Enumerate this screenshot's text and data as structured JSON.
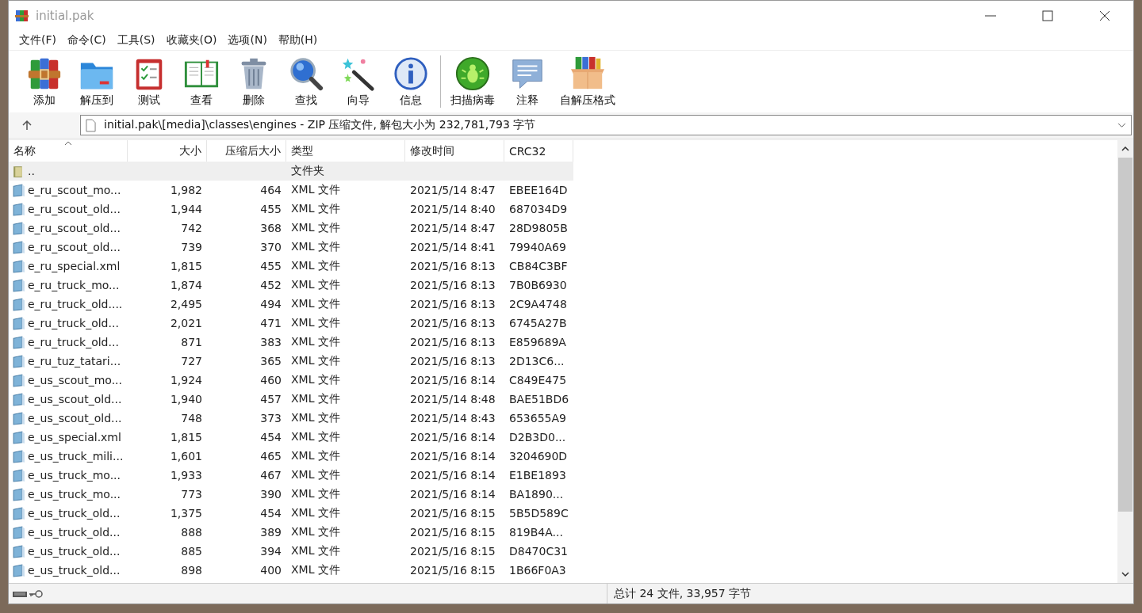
{
  "window": {
    "title": "initial.pak"
  },
  "menu": [
    "文件(F)",
    "命令(C)",
    "工具(S)",
    "收藏夹(O)",
    "选项(N)",
    "帮助(H)"
  ],
  "toolbar": {
    "groups": [
      {
        "buttons": [
          "添加",
          "解压到",
          "测试",
          "查看",
          "删除",
          "查找",
          "向导",
          "信息"
        ]
      },
      {
        "buttons": [
          "扫描病毒",
          "注释",
          "自解压格式"
        ]
      }
    ]
  },
  "address": {
    "path": "initial.pak\\[media]\\classes\\engines - ZIP 压缩文件, 解包大小为 232,781,793 字节"
  },
  "table": {
    "columns": [
      {
        "label": "名称",
        "sorted": true
      },
      {
        "label": "大小",
        "sorted": false
      },
      {
        "label": "压缩后大小",
        "sorted": false
      },
      {
        "label": "类型",
        "sorted": false
      },
      {
        "label": "修改时间",
        "sorted": false
      },
      {
        "label": "CRC32",
        "sorted": false
      }
    ],
    "rows": [
      {
        "kind": "parent",
        "selected": true,
        "cells": [
          "..",
          "",
          "",
          "文件夹",
          "",
          ""
        ]
      },
      {
        "kind": "file",
        "selected": false,
        "cells": [
          "e_ru_scout_mo...",
          "1,982",
          "464",
          "XML 文件",
          "2021/5/14 8:47",
          "EBEE164D"
        ]
      },
      {
        "kind": "file",
        "selected": false,
        "cells": [
          "e_ru_scout_old...",
          "1,944",
          "455",
          "XML 文件",
          "2021/5/14 8:40",
          "687034D9"
        ]
      },
      {
        "kind": "file",
        "selected": false,
        "cells": [
          "e_ru_scout_old...",
          "742",
          "368",
          "XML 文件",
          "2021/5/14 8:47",
          "28D9805B"
        ]
      },
      {
        "kind": "file",
        "selected": false,
        "cells": [
          "e_ru_scout_old...",
          "739",
          "370",
          "XML 文件",
          "2021/5/14 8:41",
          "79940A69"
        ]
      },
      {
        "kind": "file",
        "selected": false,
        "cells": [
          "e_ru_special.xml",
          "1,815",
          "455",
          "XML 文件",
          "2021/5/16 8:13",
          "CB84C3BF"
        ]
      },
      {
        "kind": "file",
        "selected": false,
        "cells": [
          "e_ru_truck_mo...",
          "1,874",
          "452",
          "XML 文件",
          "2021/5/16 8:13",
          "7B0B6930"
        ]
      },
      {
        "kind": "file",
        "selected": false,
        "cells": [
          "e_ru_truck_old....",
          "2,495",
          "494",
          "XML 文件",
          "2021/5/16 8:13",
          "2C9A4748"
        ]
      },
      {
        "kind": "file",
        "selected": false,
        "cells": [
          "e_ru_truck_old...",
          "2,021",
          "471",
          "XML 文件",
          "2021/5/16 8:13",
          "6745A27B"
        ]
      },
      {
        "kind": "file",
        "selected": false,
        "cells": [
          "e_ru_truck_old...",
          "871",
          "383",
          "XML 文件",
          "2021/5/16 8:13",
          "E859689A"
        ]
      },
      {
        "kind": "file",
        "selected": false,
        "cells": [
          "e_ru_tuz_tatari...",
          "727",
          "365",
          "XML 文件",
          "2021/5/16 8:13",
          "2D13C6..."
        ]
      },
      {
        "kind": "file",
        "selected": false,
        "cells": [
          "e_us_scout_mo...",
          "1,924",
          "460",
          "XML 文件",
          "2021/5/16 8:14",
          "C849E475"
        ]
      },
      {
        "kind": "file",
        "selected": false,
        "cells": [
          "e_us_scout_old...",
          "1,940",
          "457",
          "XML 文件",
          "2021/5/14 8:48",
          "BAE51BD6"
        ]
      },
      {
        "kind": "file",
        "selected": false,
        "cells": [
          "e_us_scout_old...",
          "748",
          "373",
          "XML 文件",
          "2021/5/14 8:43",
          "653655A9"
        ]
      },
      {
        "kind": "file",
        "selected": false,
        "cells": [
          "e_us_special.xml",
          "1,815",
          "454",
          "XML 文件",
          "2021/5/16 8:14",
          "D2B3D0..."
        ]
      },
      {
        "kind": "file",
        "selected": false,
        "cells": [
          "e_us_truck_mili...",
          "1,601",
          "465",
          "XML 文件",
          "2021/5/16 8:14",
          "3204690D"
        ]
      },
      {
        "kind": "file",
        "selected": false,
        "cells": [
          "e_us_truck_mo...",
          "1,933",
          "467",
          "XML 文件",
          "2021/5/16 8:14",
          "E1BE1893"
        ]
      },
      {
        "kind": "file",
        "selected": false,
        "cells": [
          "e_us_truck_mo...",
          "773",
          "390",
          "XML 文件",
          "2021/5/16 8:14",
          "BA1890..."
        ]
      },
      {
        "kind": "file",
        "selected": false,
        "cells": [
          "e_us_truck_old...",
          "1,375",
          "454",
          "XML 文件",
          "2021/5/16 8:15",
          "5B5D589C"
        ]
      },
      {
        "kind": "file",
        "selected": false,
        "cells": [
          "e_us_truck_old...",
          "888",
          "389",
          "XML 文件",
          "2021/5/16 8:15",
          "819B4A..."
        ]
      },
      {
        "kind": "file",
        "selected": false,
        "cells": [
          "e_us_truck_old...",
          "885",
          "394",
          "XML 文件",
          "2021/5/16 8:15",
          "D8470C31"
        ]
      },
      {
        "kind": "file",
        "selected": false,
        "cells": [
          "e_us_truck_old...",
          "898",
          "400",
          "XML 文件",
          "2021/5/16 8:15",
          "1B66F0A3"
        ]
      }
    ]
  },
  "status_bar": {
    "summary": "总计 24 文件, 33,957 字节"
  }
}
